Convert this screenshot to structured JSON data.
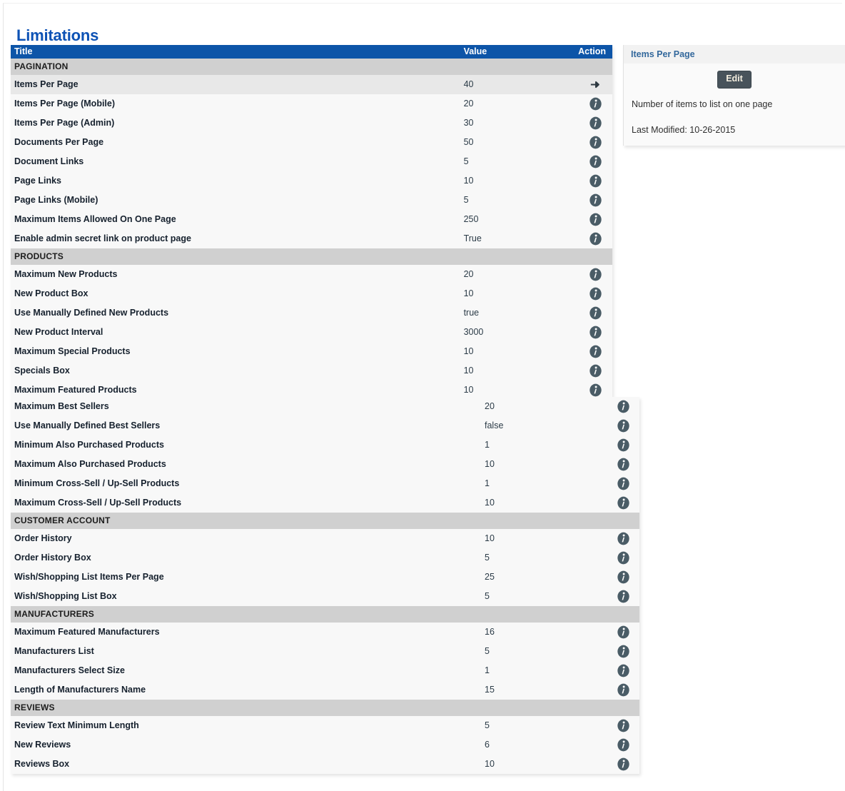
{
  "page": {
    "title": "Limitations"
  },
  "table": {
    "columns": {
      "title": "Title",
      "value": "Value",
      "action": "Action"
    },
    "icons": {
      "info": "info-icon",
      "arrow": "arrow-right-icon"
    },
    "sections": [
      {
        "name": "PAGINATION",
        "rows": [
          {
            "title": "Items Per Page",
            "value": "40",
            "action": "arrow-right-icon",
            "selected": true
          },
          {
            "title": "Items Per Page (Mobile)",
            "value": "20",
            "action": "info-icon",
            "selected": false
          },
          {
            "title": "Items Per Page (Admin)",
            "value": "30",
            "action": "info-icon",
            "selected": false
          },
          {
            "title": "Documents Per Page",
            "value": "50",
            "action": "info-icon",
            "selected": false
          },
          {
            "title": "Document Links",
            "value": "5",
            "action": "info-icon",
            "selected": false
          },
          {
            "title": "Page Links",
            "value": "10",
            "action": "info-icon",
            "selected": false
          },
          {
            "title": "Page Links (Mobile)",
            "value": "5",
            "action": "info-icon",
            "selected": false
          },
          {
            "title": "Maximum Items Allowed On One Page",
            "value": "250",
            "action": "info-icon",
            "selected": false
          },
          {
            "title": "Enable admin secret link on product page",
            "value": "True",
            "action": "info-icon",
            "selected": false
          }
        ]
      },
      {
        "name": "PRODUCTS",
        "rows": [
          {
            "title": "Maximum New Products",
            "value": "20",
            "action": "info-icon",
            "selected": false
          },
          {
            "title": "New Product Box",
            "value": "10",
            "action": "info-icon",
            "selected": false
          },
          {
            "title": "Use Manually Defined New Products",
            "value": "true",
            "action": "info-icon",
            "selected": false
          },
          {
            "title": "New Product Interval",
            "value": "3000",
            "action": "info-icon",
            "selected": false
          },
          {
            "title": "Maximum Special Products",
            "value": "10",
            "action": "info-icon",
            "selected": false
          },
          {
            "title": "Specials Box",
            "value": "10",
            "action": "info-icon",
            "selected": false
          },
          {
            "title": "Maximum Featured Products",
            "value": "10",
            "action": "info-icon",
            "selected": false
          }
        ]
      }
    ],
    "sections_lower": [
      {
        "name": null,
        "rows": [
          {
            "title": "Maximum Best Sellers",
            "value": "20",
            "action": "info-icon",
            "selected": false
          },
          {
            "title": "Use Manually Defined Best Sellers",
            "value": "false",
            "action": "info-icon",
            "selected": false
          },
          {
            "title": "Minimum Also Purchased Products",
            "value": "1",
            "action": "info-icon",
            "selected": false
          },
          {
            "title": "Maximum Also Purchased Products",
            "value": "10",
            "action": "info-icon",
            "selected": false
          },
          {
            "title": "Minimum Cross-Sell / Up-Sell Products",
            "value": "1",
            "action": "info-icon",
            "selected": false
          },
          {
            "title": "Maximum Cross-Sell / Up-Sell Products",
            "value": "10",
            "action": "info-icon",
            "selected": false
          }
        ]
      },
      {
        "name": "CUSTOMER ACCOUNT",
        "rows": [
          {
            "title": "Order History",
            "value": "10",
            "action": "info-icon",
            "selected": false
          },
          {
            "title": "Order History Box",
            "value": "5",
            "action": "info-icon",
            "selected": false
          },
          {
            "title": "Wish/Shopping List Items Per Page",
            "value": "25",
            "action": "info-icon",
            "selected": false
          },
          {
            "title": "Wish/Shopping List Box",
            "value": "5",
            "action": "info-icon",
            "selected": false
          }
        ]
      },
      {
        "name": "MANUFACTURERS",
        "rows": [
          {
            "title": "Maximum Featured Manufacturers",
            "value": "16",
            "action": "info-icon",
            "selected": false
          },
          {
            "title": "Manufacturers List",
            "value": "5",
            "action": "info-icon",
            "selected": false
          },
          {
            "title": "Manufacturers Select Size",
            "value": "1",
            "action": "info-icon",
            "selected": false
          },
          {
            "title": "Length of Manufacturers Name",
            "value": "15",
            "action": "info-icon",
            "selected": false
          }
        ]
      },
      {
        "name": "REVIEWS",
        "rows": [
          {
            "title": "Review Text Minimum Length",
            "value": "5",
            "action": "info-icon",
            "selected": false
          },
          {
            "title": "New Reviews",
            "value": "6",
            "action": "info-icon",
            "selected": false
          },
          {
            "title": "Reviews Box",
            "value": "10",
            "action": "info-icon",
            "selected": false
          }
        ]
      }
    ]
  },
  "detail": {
    "heading": "Items Per Page",
    "edit_label": "Edit",
    "description": "Number of items to list on one page",
    "last_modified": "Last Modified: 10-26-2015"
  },
  "colors": {
    "header_blue": "#0d55a8",
    "title_blue": "#0d52b5",
    "section_grey": "#d0d0d0",
    "row_bg": "#f8f8f8",
    "row_selected": "#e8e8e8",
    "icon_slate": "#4a5c66",
    "button_dark": "#48535b",
    "panel_title": "#33689c"
  }
}
